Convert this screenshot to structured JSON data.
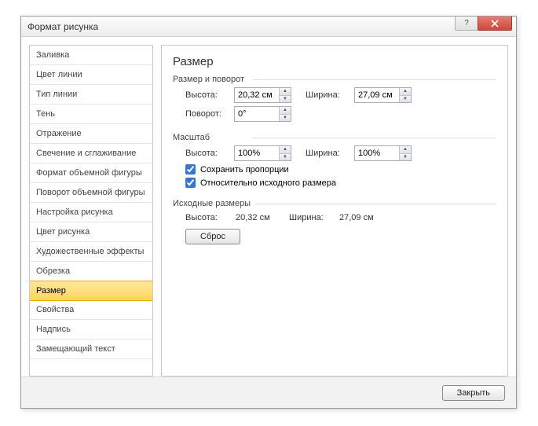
{
  "title": "Формат рисунка",
  "sidebar": {
    "items": [
      {
        "label": "Заливка"
      },
      {
        "label": "Цвет линии"
      },
      {
        "label": "Тип линии"
      },
      {
        "label": "Тень"
      },
      {
        "label": "Отражение"
      },
      {
        "label": "Свечение и сглаживание"
      },
      {
        "label": "Формат объемной фигуры"
      },
      {
        "label": "Поворот объемной фигуры"
      },
      {
        "label": "Настройка рисунка"
      },
      {
        "label": "Цвет рисунка"
      },
      {
        "label": "Художественные эффекты"
      },
      {
        "label": "Обрезка"
      },
      {
        "label": "Размер"
      },
      {
        "label": "Свойства"
      },
      {
        "label": "Надпись"
      },
      {
        "label": "Замещающий текст"
      }
    ],
    "selected_index": 12
  },
  "panel": {
    "heading": "Размер",
    "group1": {
      "legend": "Размер и поворот",
      "height_label": "Высота:",
      "height_value": "20,32 см",
      "width_label": "Ширина:",
      "width_value": "27,09 см",
      "rotation_label": "Поворот:",
      "rotation_value": "0°"
    },
    "group2": {
      "legend": "Масштаб",
      "height_label": "Высота:",
      "height_value": "100%",
      "width_label": "Ширина:",
      "width_value": "100%",
      "cb1_label": "Сохранить пропорции",
      "cb1_checked": true,
      "cb2_label": "Относительно исходного размера",
      "cb2_checked": true
    },
    "group3": {
      "legend": "Исходные размеры",
      "height_label": "Высота:",
      "height_value": "20,32 см",
      "width_label": "Ширина:",
      "width_value": "27,09 см",
      "reset_label": "Сброс"
    }
  },
  "footer": {
    "close_label": "Закрыть"
  }
}
